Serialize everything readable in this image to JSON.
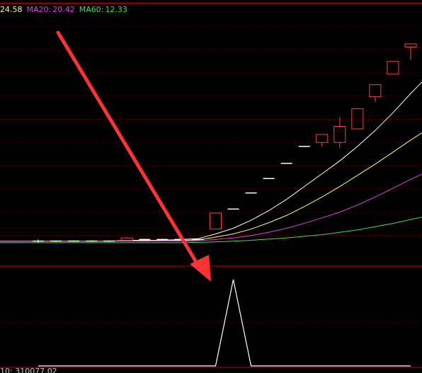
{
  "legend": {
    "ma_prev_value": "24.58",
    "ma20_label": "MA20:",
    "ma20_value": "20.42",
    "ma60_label": "MA60:",
    "ma60_value": "12.33"
  },
  "bottom_indicator_text": "10: 310077.02",
  "colors": {
    "background": "#000000",
    "grid": "#8b0000",
    "panel_border": "#c00000",
    "candle_up": "#ff4040",
    "candle_flat": "#ffffff",
    "ma_white": "#ffffff",
    "ma_yellow": "#ffff66",
    "ma20": "#e040e0",
    "ma60": "#40e040",
    "arrow": "#ff3333",
    "indicator": "#ffffff"
  },
  "chart_data": {
    "type": "candlestick",
    "price_panel": {
      "ylim": [
        0,
        30
      ],
      "candles": [
        {
          "i": 0,
          "open": 1.0,
          "close": 1.0,
          "high": 1.2,
          "low": 0.8
        },
        {
          "i": 1,
          "open": 1.0,
          "close": 1.0,
          "high": 1.1,
          "low": 0.9
        },
        {
          "i": 2,
          "open": 1.0,
          "close": 1.0,
          "high": 1.1,
          "low": 0.9
        },
        {
          "i": 3,
          "open": 1.0,
          "close": 1.0,
          "high": 1.1,
          "low": 0.9
        },
        {
          "i": 4,
          "open": 1.0,
          "close": 1.0,
          "high": 1.1,
          "low": 0.9
        },
        {
          "i": 5,
          "open": 1.1,
          "close": 1.4,
          "high": 1.5,
          "low": 1.0
        },
        {
          "i": 6,
          "open": 1.2,
          "close": 1.2,
          "high": 1.3,
          "low": 1.1
        },
        {
          "i": 7,
          "open": 1.2,
          "close": 1.2,
          "high": 1.3,
          "low": 1.1
        },
        {
          "i": 8,
          "open": 1.2,
          "close": 1.2,
          "high": 1.3,
          "low": 1.1
        },
        {
          "i": 9,
          "open": 1.2,
          "close": 1.2,
          "high": 1.3,
          "low": 1.1
        },
        {
          "i": 10,
          "open": 2.5,
          "close": 4.5,
          "high": 4.5,
          "low": 2.5
        },
        {
          "i": 11,
          "open": 5.0,
          "close": 5.0,
          "high": 5.0,
          "low": 5.0
        },
        {
          "i": 12,
          "open": 7.0,
          "close": 7.0,
          "high": 7.0,
          "low": 7.0
        },
        {
          "i": 13,
          "open": 8.8,
          "close": 8.8,
          "high": 8.8,
          "low": 8.8
        },
        {
          "i": 14,
          "open": 10.7,
          "close": 10.7,
          "high": 10.7,
          "low": 10.7
        },
        {
          "i": 15,
          "open": 12.8,
          "close": 12.8,
          "high": 12.8,
          "low": 12.8
        },
        {
          "i": 16,
          "open": 13.3,
          "close": 14.3,
          "high": 14.3,
          "low": 12.8
        },
        {
          "i": 17,
          "open": 13.3,
          "close": 15.3,
          "high": 16.5,
          "low": 12.6
        },
        {
          "i": 18,
          "open": 15.0,
          "close": 17.5,
          "high": 17.6,
          "low": 15.0
        },
        {
          "i": 19,
          "open": 19.0,
          "close": 20.5,
          "high": 20.5,
          "low": 18.3
        },
        {
          "i": 20,
          "open": 21.8,
          "close": 23.4,
          "high": 23.4,
          "low": 21.8
        },
        {
          "i": 21,
          "open": 25.2,
          "close": 25.6,
          "high": 25.6,
          "low": 23.6
        }
      ],
      "ma_series": [
        {
          "color_key": "ma_white",
          "values": [
            1.0,
            1.0,
            1.0,
            1.0,
            1.0,
            1.1,
            1.1,
            1.1,
            1.2,
            1.3,
            1.9,
            2.6,
            3.6,
            4.8,
            6.2,
            7.8,
            9.4,
            11.0,
            12.8,
            14.8,
            17.0,
            19.4
          ]
        },
        {
          "color_key": "ma_yellow",
          "values": [
            1.0,
            1.0,
            1.0,
            1.0,
            1.0,
            1.05,
            1.05,
            1.1,
            1.1,
            1.15,
            1.5,
            1.9,
            2.5,
            3.3,
            4.2,
            5.3,
            6.5,
            7.8,
            9.2,
            10.6,
            12.1,
            13.6
          ]
        },
        {
          "color_key": "ma20",
          "values": [
            1.0,
            1.0,
            1.0,
            1.0,
            1.0,
            1.0,
            1.0,
            1.0,
            1.0,
            1.05,
            1.2,
            1.4,
            1.7,
            2.1,
            2.6,
            3.2,
            3.9,
            4.6,
            5.5,
            6.5,
            7.6,
            8.7
          ]
        },
        {
          "color_key": "ma60",
          "values": [
            0.8,
            0.8,
            0.8,
            0.8,
            0.8,
            0.8,
            0.8,
            0.8,
            0.8,
            0.85,
            0.9,
            1.0,
            1.1,
            1.25,
            1.4,
            1.6,
            1.8,
            2.1,
            2.4,
            2.8,
            3.2,
            3.7
          ]
        }
      ]
    },
    "indicator_panel": {
      "ylim": [
        0,
        100
      ],
      "values": [
        0,
        0,
        0,
        0,
        0,
        0,
        0,
        0,
        0,
        0,
        0,
        100,
        0,
        0,
        0,
        0,
        0,
        0,
        0,
        0,
        0,
        0
      ]
    }
  }
}
